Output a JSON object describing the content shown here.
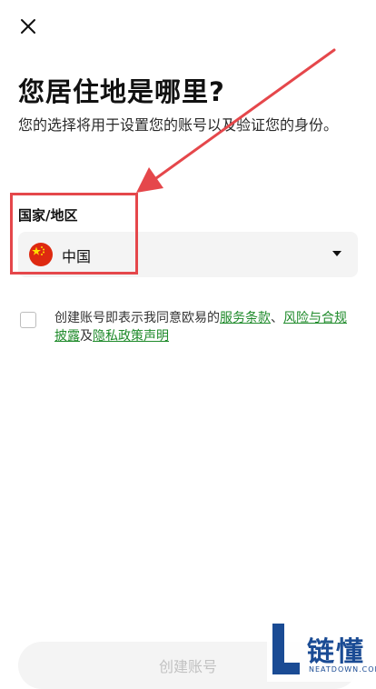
{
  "header": {
    "close_icon": "close-icon"
  },
  "page": {
    "title": "您居住地是哪里?",
    "subtitle": "您的选择将用于设置您的账号以及验证您的身份。"
  },
  "country_field": {
    "label": "国家/地区",
    "value": "中国",
    "flag_icon": "china-flag-icon"
  },
  "terms": {
    "prefix": "创建账号即表示我同意欧易的",
    "link1": "服务条款",
    "sep": "、",
    "link2": "风险与合规披露",
    "conj": "及",
    "link3": "隐私政策声明",
    "checked": false
  },
  "create_button": {
    "label": "创建账号",
    "enabled": false
  },
  "watermark": {
    "brand_cn": "链懂",
    "brand_en": "NEATDOWN.COM"
  },
  "colors": {
    "link": "#1e8a2a",
    "annotation": "#e5474b",
    "button_bg": "#f4f4f4",
    "button_text_disabled": "#c2c2c2"
  }
}
